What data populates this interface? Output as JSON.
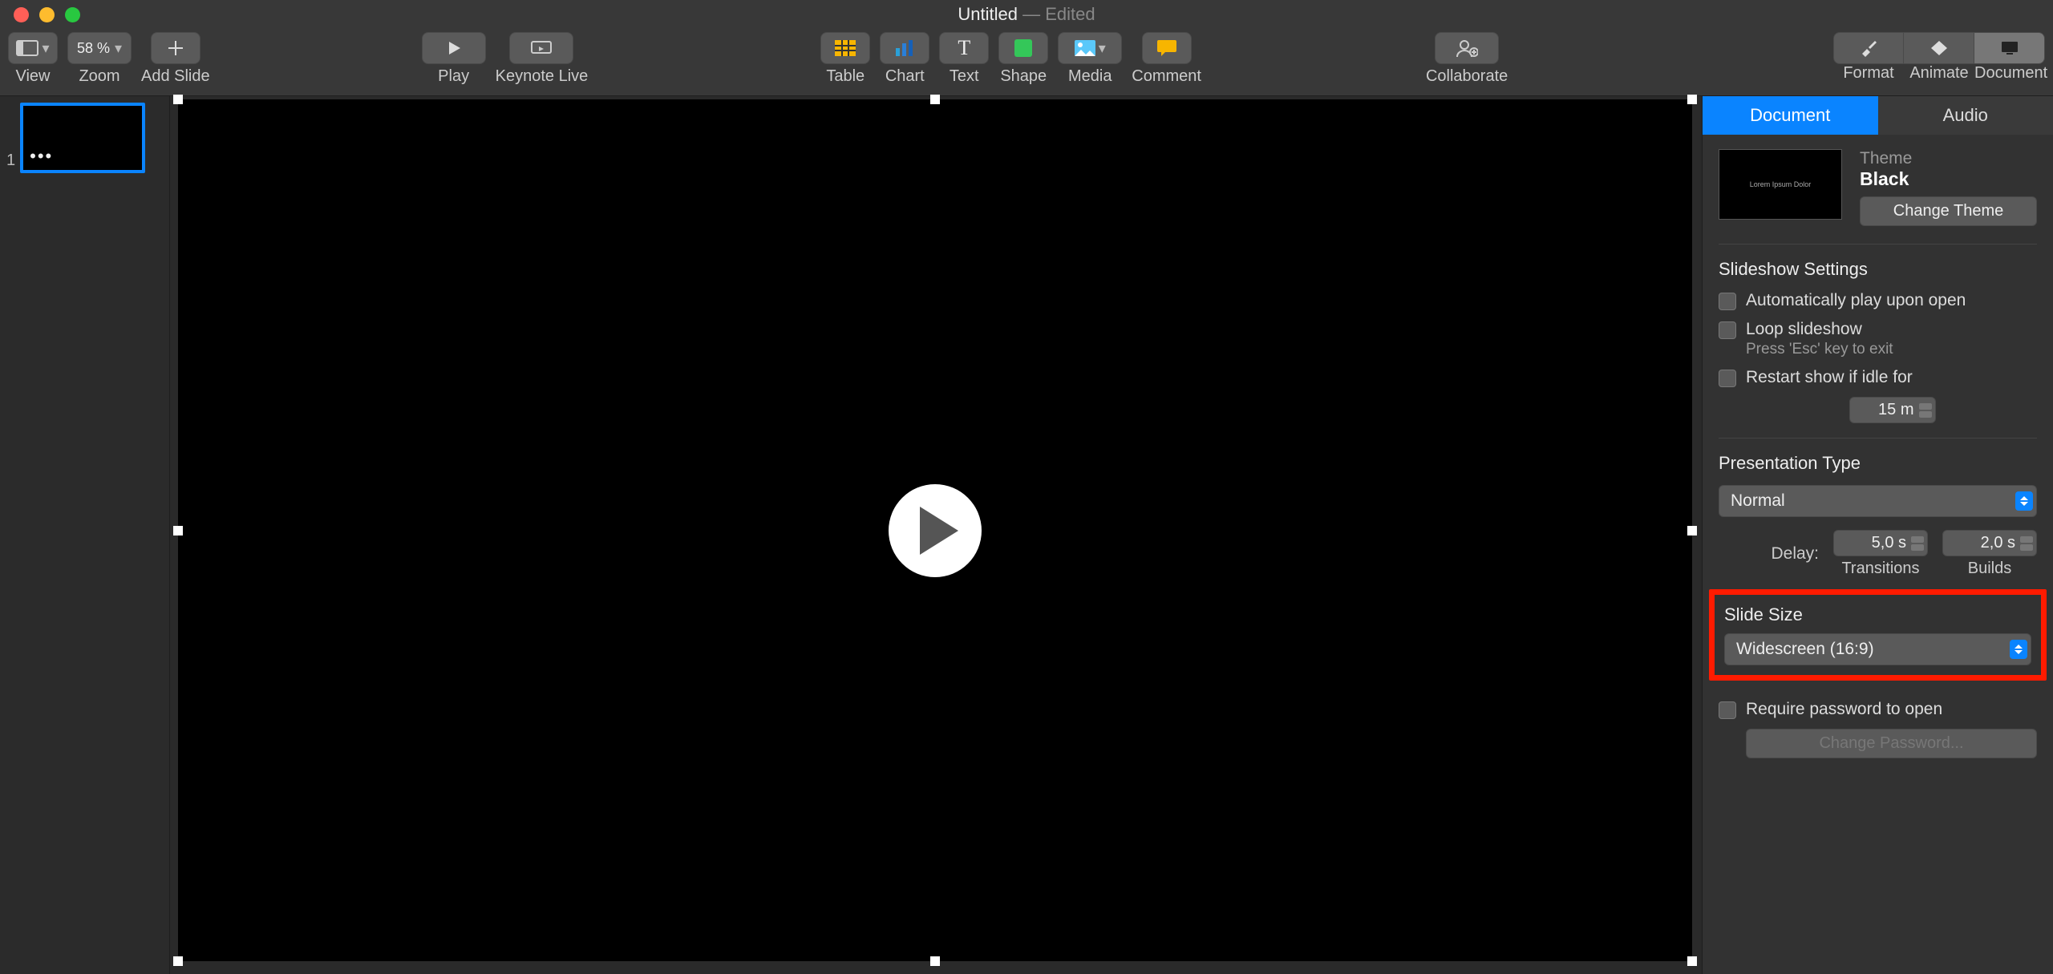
{
  "titlebar": {
    "name": "Untitled",
    "status": "— Edited"
  },
  "toolbar": {
    "view": "View",
    "zoom_value": "58 %",
    "zoom": "Zoom",
    "add_slide": "Add Slide",
    "play": "Play",
    "keynote_live": "Keynote Live",
    "table": "Table",
    "chart": "Chart",
    "text": "Text",
    "shape": "Shape",
    "media": "Media",
    "comment": "Comment",
    "collaborate": "Collaborate",
    "format": "Format",
    "animate": "Animate",
    "document": "Document"
  },
  "navigator": {
    "slide_number": "1"
  },
  "inspector": {
    "tabs": {
      "document": "Document",
      "audio": "Audio"
    },
    "theme": {
      "label": "Theme",
      "name": "Black",
      "thumb_text": "Lorem Ipsum Dolor",
      "change_btn": "Change Theme"
    },
    "slideshow": {
      "title": "Slideshow Settings",
      "auto_play": "Automatically play upon open",
      "loop": "Loop slideshow",
      "loop_sub": "Press 'Esc' key to exit",
      "restart": "Restart show if idle for",
      "idle_value": "15 m"
    },
    "presentation_type": {
      "title": "Presentation Type",
      "value": "Normal",
      "delay_label": "Delay:",
      "transitions_value": "5,0 s",
      "transitions": "Transitions",
      "builds_value": "2,0 s",
      "builds": "Builds"
    },
    "slide_size": {
      "title": "Slide Size",
      "value": "Widescreen (16:9)"
    },
    "password": {
      "require": "Require password to open",
      "change_btn": "Change Password..."
    }
  }
}
